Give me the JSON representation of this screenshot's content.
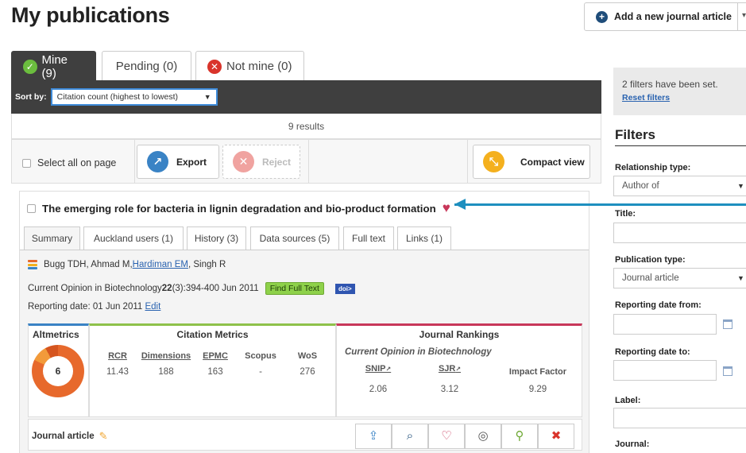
{
  "page_title": "My publications",
  "add_button_label": "Add a new journal article",
  "tabs": {
    "mine": "Mine (9)",
    "pending": "Pending (0)",
    "not_mine": "Not mine (0)"
  },
  "sort": {
    "label": "Sort by:",
    "selected": "Citation count (highest to lowest)"
  },
  "results": "9 results",
  "actions": {
    "select_all": "Select all on page",
    "export": "Export",
    "reject": "Reject",
    "compact_view": "Compact view"
  },
  "publication": {
    "title": "The emerging role for bacteria in lignin degradation and bio-product formation",
    "tabs": [
      "Summary",
      "Auckland users (1)",
      "History (3)",
      "Data sources (5)",
      "Full text",
      "Links (1)"
    ],
    "authors_pre": "Bugg TDH, Ahmad M, ",
    "author_link": "Hardiman EM",
    "authors_post": ", Singh R",
    "journal_pre": "Current Opinion in Biotechnology ",
    "volume": "22",
    "journal_post": "(3):394-400 Jun 2011",
    "find_full_text": "Find Full Text",
    "doi_badge": "doi>",
    "reporting_text": "Reporting date: 01 Jun 2011 ",
    "reporting_edit": "Edit",
    "altmetrics": {
      "title": "Altmetrics",
      "score": "6"
    },
    "citation_metrics": {
      "title": "Citation Metrics",
      "headers": [
        "RCR",
        "Dimensions",
        "EPMC",
        "Scopus",
        "WoS"
      ],
      "values": [
        "11.43",
        "188",
        "163",
        "-",
        "276"
      ]
    },
    "journal_rankings": {
      "title": "Journal Rankings",
      "journal": "Current Opinion in Biotechnology",
      "headers": [
        "SNIP",
        "SJR",
        "Impact Factor"
      ],
      "values": [
        "2.06",
        "3.12",
        "9.29"
      ]
    },
    "type": "Journal article"
  },
  "filters": {
    "status": "2 filters have been set.",
    "reset": "Reset filters",
    "title": "Filters",
    "relationship_label": "Relationship type:",
    "relationship_value": "Author of",
    "title_label": "Title:",
    "pubtype_label": "Publication type:",
    "pubtype_value": "Journal article",
    "date_from_label": "Reporting date from:",
    "date_to_label": "Reporting date to:",
    "label_label": "Label:",
    "journal_label": "Journal:"
  },
  "colors": {
    "accent_blue": "#3d8ad8",
    "dark_bar": "#3f3f3f",
    "heart": "#c8375a",
    "arrow": "#1e8fbf"
  }
}
